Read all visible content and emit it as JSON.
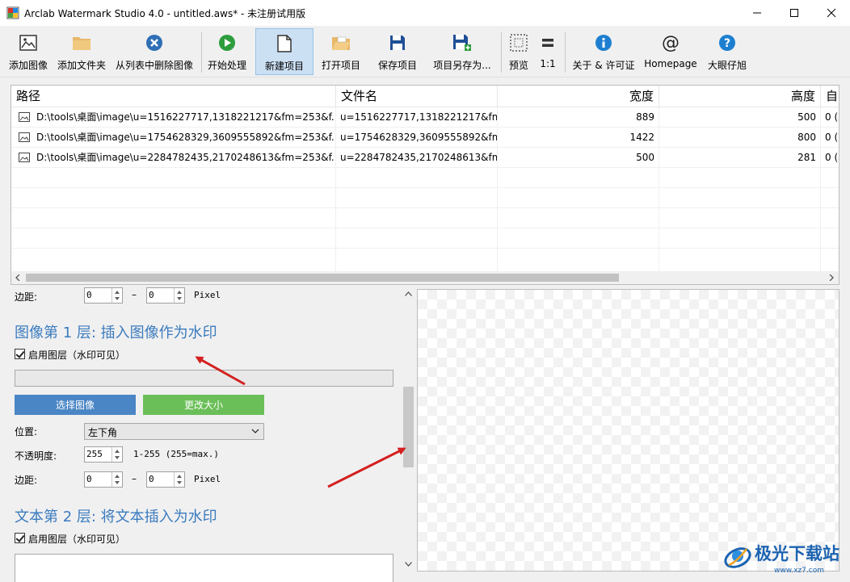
{
  "window": {
    "title": "Arclab Watermark Studio 4.0 - untitled.aws* - 未注册试用版"
  },
  "toolbar": {
    "items": [
      {
        "label": "添加图像",
        "icon": "add-image-icon"
      },
      {
        "label": "添加文件夹",
        "icon": "folder-icon"
      },
      {
        "label": "从列表中删除图像",
        "icon": "remove-icon"
      },
      {
        "label": "开始处理",
        "icon": "play-icon"
      },
      {
        "label": "新建项目",
        "icon": "new-document-icon"
      },
      {
        "label": "打开项目",
        "icon": "open-folder-icon"
      },
      {
        "label": "保存项目",
        "icon": "save-icon"
      },
      {
        "label": "项目另存为...",
        "icon": "save-as-icon"
      },
      {
        "label": "预览",
        "icon": "preview-icon"
      },
      {
        "label": "1:1",
        "icon": "actual-size-icon"
      },
      {
        "label": "关于 & 许可证",
        "icon": "info-icon"
      },
      {
        "label": "Homepage",
        "icon": "at-icon"
      },
      {
        "label": "大眼仔旭",
        "icon": "help-icon"
      }
    ],
    "active": "新建项目"
  },
  "table": {
    "columns": [
      "路径",
      "文件名",
      "宽度",
      "高度",
      "自"
    ],
    "rows": [
      {
        "path": "D:\\tools\\桌面\\image\\u=1516227717,1318221217&fm=253&f...",
        "filename": "u=1516227717,1318221217&fm=253&f...",
        "width": "889",
        "height": "500",
        "extra": "0 ("
      },
      {
        "path": "D:\\tools\\桌面\\image\\u=1754628329,3609555892&fm=253&f...",
        "filename": "u=1754628329,3609555892&fm=253&f...",
        "width": "1422",
        "height": "800",
        "extra": "0 ("
      },
      {
        "path": "D:\\tools\\桌面\\image\\u=2284782435,2170248613&fm=253&f...",
        "filename": "u=2284782435,2170248613&fm=253&f...",
        "width": "500",
        "height": "281",
        "extra": "0 ("
      }
    ]
  },
  "panel": {
    "margin_label": "边距:",
    "dash": "–",
    "pixel": "Pixel",
    "top_margin": {
      "a": "0",
      "b": "0"
    },
    "layer1": {
      "heading": "图像第 1 层:  插入图像作为水印",
      "enable_label": "启用图层（水印可见）",
      "select_button": "选择图像",
      "resize_button": "更改大小",
      "position_label": "位置:",
      "position_value": "左下角",
      "opacity_label": "不透明度:",
      "opacity_value": "255",
      "opacity_hint": "1-255 (255=max.)",
      "margin": {
        "a": "0",
        "b": "0"
      }
    },
    "layer2": {
      "heading": "文本第 2 层:  将文本插入为水印",
      "enable_label": "启用图层（水印可见）"
    }
  },
  "watermark": {
    "text": "极光下载站",
    "url": "www.xz7.com"
  },
  "colors": {
    "heading": "#3b7bbf",
    "select_button": "#4a86c5",
    "resize_button": "#6bbf59",
    "toolbar_active": "#cce0f4",
    "annotation_arrow": "#d42020"
  }
}
